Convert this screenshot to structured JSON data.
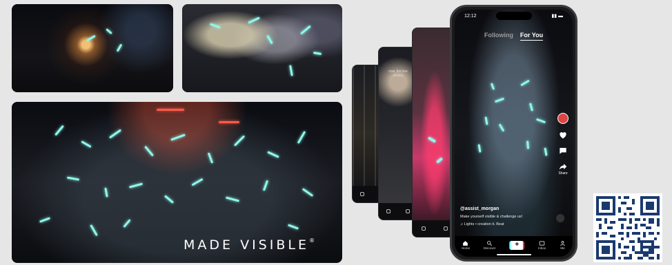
{
  "brand": {
    "wordmark": "MADE VISIBLE",
    "registered": "®"
  },
  "colors": {
    "background": "#e6e6e6",
    "reflective_cyan": "#8ff7ea",
    "accent_red": "#ff5a4a",
    "tiktok_cyan": "#25f4ee",
    "tiktok_pink": "#fe2c55"
  },
  "phone": {
    "status_time": "12:12",
    "tabs": {
      "following": "Following",
      "for_you": "For You"
    },
    "username": "@assist_morgan",
    "caption": "Make yourself visible & challenge us!",
    "music": "♫ Lights • creation it. Beat",
    "actions": [
      {
        "icon": "heart-icon",
        "count": ""
      },
      {
        "icon": "comment-icon",
        "count": ""
      },
      {
        "icon": "share-icon",
        "count": "Share"
      }
    ],
    "nav": {
      "home": "Home",
      "discover": "Discover",
      "create": "+",
      "inbox": "Inbox",
      "me": "Me"
    }
  },
  "cards": {
    "card2_text": "now, the line\nstrana:"
  }
}
